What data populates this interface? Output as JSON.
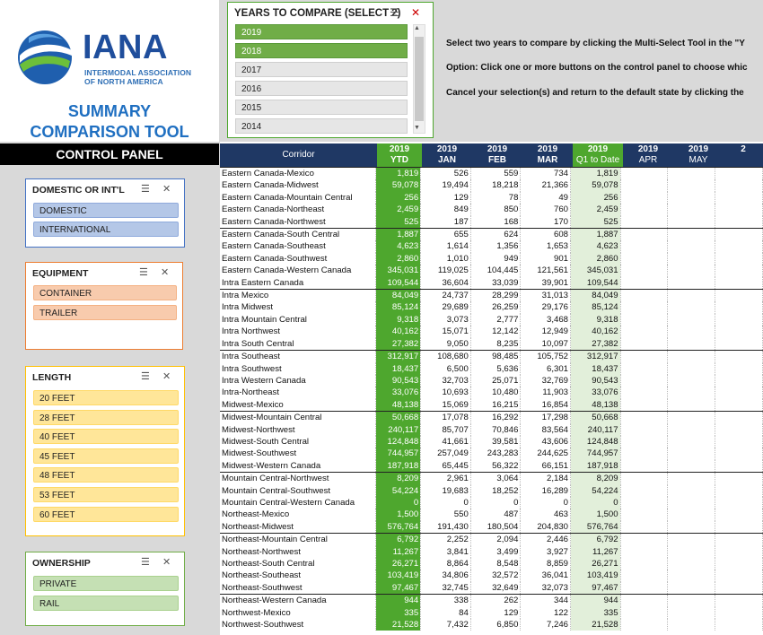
{
  "logo": {
    "name": "IANA",
    "sub_line1": "INTERMODAL ASSOCIATION",
    "sub_line2": "OF NORTH AMERICA"
  },
  "title": {
    "line1": "SUMMARY",
    "line2": "COMPARISON TOOL"
  },
  "years_slicer": {
    "title": "YEARS TO COMPARE (SELECT 2)",
    "items": [
      {
        "label": "2019",
        "selected": true
      },
      {
        "label": "2018",
        "selected": true
      },
      {
        "label": "2017",
        "selected": false
      },
      {
        "label": "2016",
        "selected": false
      },
      {
        "label": "2015",
        "selected": false
      },
      {
        "label": "2014",
        "selected": false
      }
    ]
  },
  "instructions": [
    "Select two years to compare by clicking the Multi-Select Tool in the \"Y",
    "Option: Click one or more buttons on the control panel to choose whic",
    "Cancel your selection(s) and return to the default state by clicking the"
  ],
  "control_panel": {
    "title": "CONTROL PANEL",
    "slicers": [
      {
        "title": "DOMESTIC OR INT'L",
        "items": [
          "DOMESTIC",
          "INTERNATIONAL"
        ]
      },
      {
        "title": "EQUIPMENT",
        "items": [
          "CONTAINER",
          "TRAILER"
        ]
      },
      {
        "title": "LENGTH",
        "items": [
          "20 FEET",
          "28 FEET",
          "40 FEET",
          "45 FEET",
          "48 FEET",
          "53 FEET",
          "60 FEET"
        ]
      },
      {
        "title": "OWNERSHIP",
        "items": [
          "PRIVATE",
          "RAIL"
        ]
      }
    ]
  },
  "colors": {
    "accent_green": "#4ea72e",
    "header_navy": "#1f3864",
    "title_blue": "#1f6fc1"
  },
  "table": {
    "headers": [
      {
        "l1": "Corridor",
        "l2": ""
      },
      {
        "l1": "2019",
        "l2": "YTD"
      },
      {
        "l1": "2019",
        "l2": "JAN"
      },
      {
        "l1": "2019",
        "l2": "FEB"
      },
      {
        "l1": "2019",
        "l2": "MAR"
      },
      {
        "l1": "2019",
        "l2": "Q1 to Date"
      },
      {
        "l1": "2019",
        "l2": "APR"
      },
      {
        "l1": "2019",
        "l2": "MAY"
      },
      {
        "l1": "2",
        "l2": ""
      }
    ],
    "rows": [
      {
        "c": "Eastern Canada-Mexico",
        "ytd": "1,819",
        "jan": "526",
        "feb": "559",
        "mar": "734",
        "q1": "1,819",
        "g": true
      },
      {
        "c": "Eastern Canada-Midwest",
        "ytd": "59,078",
        "jan": "19,494",
        "feb": "18,218",
        "mar": "21,366",
        "q1": "59,078",
        "g": false
      },
      {
        "c": "Eastern Canada-Mountain Central",
        "ytd": "256",
        "jan": "129",
        "feb": "78",
        "mar": "49",
        "q1": "256",
        "g": false
      },
      {
        "c": "Eastern Canada-Northeast",
        "ytd": "2,459",
        "jan": "849",
        "feb": "850",
        "mar": "760",
        "q1": "2,459",
        "g": false
      },
      {
        "c": "Eastern Canada-Northwest",
        "ytd": "525",
        "jan": "187",
        "feb": "168",
        "mar": "170",
        "q1": "525",
        "g": false
      },
      {
        "c": "Eastern Canada-South Central",
        "ytd": "1,887",
        "jan": "655",
        "feb": "624",
        "mar": "608",
        "q1": "1,887",
        "g": true
      },
      {
        "c": "Eastern Canada-Southeast",
        "ytd": "4,623",
        "jan": "1,614",
        "feb": "1,356",
        "mar": "1,653",
        "q1": "4,623",
        "g": false
      },
      {
        "c": "Eastern Canada-Southwest",
        "ytd": "2,860",
        "jan": "1,010",
        "feb": "949",
        "mar": "901",
        "q1": "2,860",
        "g": false
      },
      {
        "c": "Eastern Canada-Western Canada",
        "ytd": "345,031",
        "jan": "119,025",
        "feb": "104,445",
        "mar": "121,561",
        "q1": "345,031",
        "g": false
      },
      {
        "c": "Intra Eastern Canada",
        "ytd": "109,544",
        "jan": "36,604",
        "feb": "33,039",
        "mar": "39,901",
        "q1": "109,544",
        "g": false
      },
      {
        "c": "Intra Mexico",
        "ytd": "84,049",
        "jan": "24,737",
        "feb": "28,299",
        "mar": "31,013",
        "q1": "84,049",
        "g": true
      },
      {
        "c": "Intra Midwest",
        "ytd": "85,124",
        "jan": "29,689",
        "feb": "26,259",
        "mar": "29,176",
        "q1": "85,124",
        "g": false
      },
      {
        "c": "Intra Mountain Central",
        "ytd": "9,318",
        "jan": "3,073",
        "feb": "2,777",
        "mar": "3,468",
        "q1": "9,318",
        "g": false
      },
      {
        "c": "Intra Northwest",
        "ytd": "40,162",
        "jan": "15,071",
        "feb": "12,142",
        "mar": "12,949",
        "q1": "40,162",
        "g": false
      },
      {
        "c": "Intra South Central",
        "ytd": "27,382",
        "jan": "9,050",
        "feb": "8,235",
        "mar": "10,097",
        "q1": "27,382",
        "g": false
      },
      {
        "c": "Intra Southeast",
        "ytd": "312,917",
        "jan": "108,680",
        "feb": "98,485",
        "mar": "105,752",
        "q1": "312,917",
        "g": true
      },
      {
        "c": "Intra Southwest",
        "ytd": "18,437",
        "jan": "6,500",
        "feb": "5,636",
        "mar": "6,301",
        "q1": "18,437",
        "g": false
      },
      {
        "c": "Intra Western Canada",
        "ytd": "90,543",
        "jan": "32,703",
        "feb": "25,071",
        "mar": "32,769",
        "q1": "90,543",
        "g": false
      },
      {
        "c": "Intra-Northeast",
        "ytd": "33,076",
        "jan": "10,693",
        "feb": "10,480",
        "mar": "11,903",
        "q1": "33,076",
        "g": false
      },
      {
        "c": "Midwest-Mexico",
        "ytd": "48,138",
        "jan": "15,069",
        "feb": "16,215",
        "mar": "16,854",
        "q1": "48,138",
        "g": false
      },
      {
        "c": "Midwest-Mountain Central",
        "ytd": "50,668",
        "jan": "17,078",
        "feb": "16,292",
        "mar": "17,298",
        "q1": "50,668",
        "g": true
      },
      {
        "c": "Midwest-Northwest",
        "ytd": "240,117",
        "jan": "85,707",
        "feb": "70,846",
        "mar": "83,564",
        "q1": "240,117",
        "g": false
      },
      {
        "c": "Midwest-South Central",
        "ytd": "124,848",
        "jan": "41,661",
        "feb": "39,581",
        "mar": "43,606",
        "q1": "124,848",
        "g": false
      },
      {
        "c": "Midwest-Southwest",
        "ytd": "744,957",
        "jan": "257,049",
        "feb": "243,283",
        "mar": "244,625",
        "q1": "744,957",
        "g": false
      },
      {
        "c": "Midwest-Western Canada",
        "ytd": "187,918",
        "jan": "65,445",
        "feb": "56,322",
        "mar": "66,151",
        "q1": "187,918",
        "g": false
      },
      {
        "c": "Mountain Central-Northwest",
        "ytd": "8,209",
        "jan": "2,961",
        "feb": "3,064",
        "mar": "2,184",
        "q1": "8,209",
        "g": true
      },
      {
        "c": "Mountain Central-Southwest",
        "ytd": "54,224",
        "jan": "19,683",
        "feb": "18,252",
        "mar": "16,289",
        "q1": "54,224",
        "g": false
      },
      {
        "c": "Mountain Central-Western Canada",
        "ytd": "0",
        "jan": "0",
        "feb": "0",
        "mar": "0",
        "q1": "0",
        "g": false
      },
      {
        "c": "Northeast-Mexico",
        "ytd": "1,500",
        "jan": "550",
        "feb": "487",
        "mar": "463",
        "q1": "1,500",
        "g": false
      },
      {
        "c": "Northeast-Midwest",
        "ytd": "576,764",
        "jan": "191,430",
        "feb": "180,504",
        "mar": "204,830",
        "q1": "576,764",
        "g": false
      },
      {
        "c": "Northeast-Mountain Central",
        "ytd": "6,792",
        "jan": "2,252",
        "feb": "2,094",
        "mar": "2,446",
        "q1": "6,792",
        "g": true
      },
      {
        "c": "Northeast-Northwest",
        "ytd": "11,267",
        "jan": "3,841",
        "feb": "3,499",
        "mar": "3,927",
        "q1": "11,267",
        "g": false
      },
      {
        "c": "Northeast-South Central",
        "ytd": "26,271",
        "jan": "8,864",
        "feb": "8,548",
        "mar": "8,859",
        "q1": "26,271",
        "g": false
      },
      {
        "c": "Northeast-Southeast",
        "ytd": "103,419",
        "jan": "34,806",
        "feb": "32,572",
        "mar": "36,041",
        "q1": "103,419",
        "g": false
      },
      {
        "c": "Northeast-Southwest",
        "ytd": "97,467",
        "jan": "32,745",
        "feb": "32,649",
        "mar": "32,073",
        "q1": "97,467",
        "g": false
      },
      {
        "c": "Northeast-Western Canada",
        "ytd": "944",
        "jan": "338",
        "feb": "262",
        "mar": "344",
        "q1": "944",
        "g": true
      },
      {
        "c": "Northwest-Mexico",
        "ytd": "335",
        "jan": "84",
        "feb": "129",
        "mar": "122",
        "q1": "335",
        "g": false
      },
      {
        "c": "Northwest-Southwest",
        "ytd": "21,528",
        "jan": "7,432",
        "feb": "6,850",
        "mar": "7,246",
        "q1": "21,528",
        "g": false
      }
    ]
  }
}
